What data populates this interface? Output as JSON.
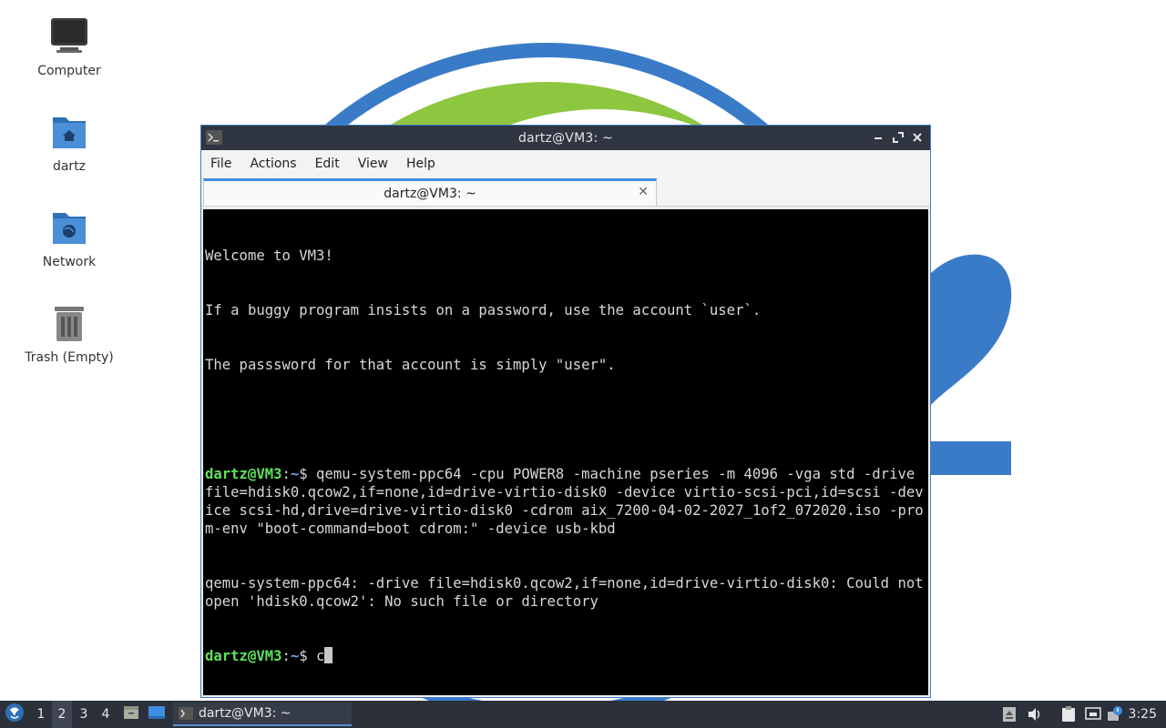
{
  "desktop": {
    "icons": [
      {
        "label": "Computer"
      },
      {
        "label": "dartz"
      },
      {
        "label": "Network"
      },
      {
        "label": "Trash (Empty)"
      }
    ]
  },
  "window": {
    "title": "dartz@VM3: ~",
    "menu": [
      "File",
      "Actions",
      "Edit",
      "View",
      "Help"
    ],
    "tab_label": "dartz@VM3: ~",
    "tab_close": "✕"
  },
  "terminal": {
    "welcome": [
      "Welcome to VM3!",
      "If a buggy program insists on a password, use the account `user`.",
      "The passsword for that account is simply \"user\"."
    ],
    "prompt_user": "dartz@VM3",
    "prompt_path": "~",
    "prompt_symbol": "$",
    "command": " qemu-system-ppc64 -cpu POWER8 -machine pseries -m 4096 -vga std -drive file=hdisk0.qcow2,if=none,id=drive-virtio-disk0 -device virtio-scsi-pci,id=scsi -device scsi-hd,drive=drive-virtio-disk0 -cdrom aix_7200-04-02-2027_1of2_072020.iso -prom-env \"boot-command=boot cdrom:\" -device usb-kbd",
    "error": "qemu-system-ppc64: -drive file=hdisk0.qcow2,if=none,id=drive-virtio-disk0: Could not open 'hdisk0.qcow2': No such file or directory",
    "current_input": " c"
  },
  "taskbar": {
    "workspaces": [
      "1",
      "2",
      "3",
      "4"
    ],
    "active_workspace": "2",
    "task_label": "dartz@VM3: ~",
    "clock": "3:25"
  },
  "colors": {
    "wallpaper_blue": "#3a7bc8",
    "wallpaper_green": "#8dc63f",
    "taskbar": "#2b303b",
    "titlebar": "#2f3541"
  }
}
